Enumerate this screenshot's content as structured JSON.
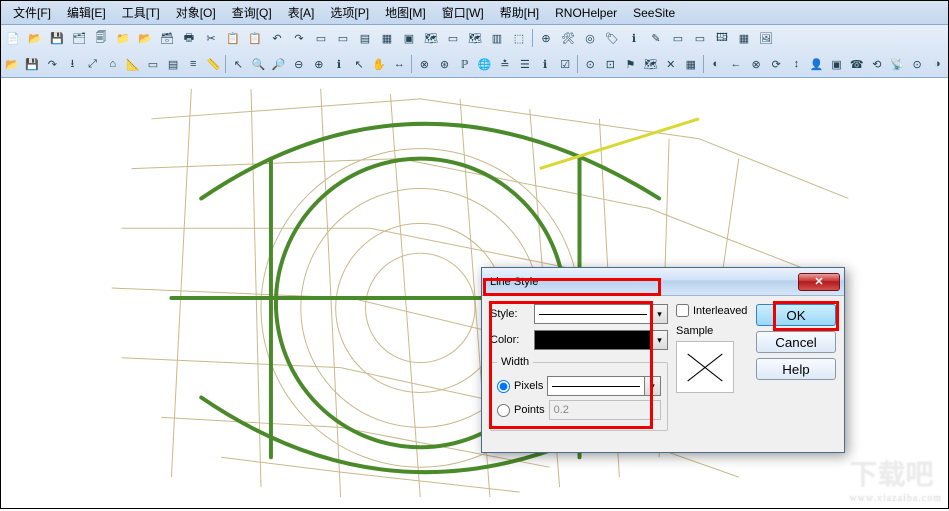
{
  "menubar": {
    "items": [
      "文件[F]",
      "编辑[E]",
      "工具[T]",
      "对象[O]",
      "查询[Q]",
      "表[A]",
      "选项[P]",
      "地图[M]",
      "窗口[W]",
      "帮助[H]",
      "RNOHelper",
      "SeeSite"
    ]
  },
  "toolbar_icons_row1": [
    "📄",
    "📂",
    "💾",
    "🗂",
    "🗐",
    "📁",
    "📂",
    "🗃",
    "🖶",
    "✂",
    "📋",
    "📋",
    "↶",
    "↷",
    "▭",
    "▭",
    "▤",
    "▦",
    "▣",
    "🗺",
    "▭",
    "🗺",
    "▥",
    "⬚",
    "|",
    "⊕",
    "🛠",
    "◎",
    "🏷",
    "ℹ",
    "✎",
    "▭",
    "▭",
    "🖽",
    "▦",
    "🖼"
  ],
  "toolbar_icons_row2": [
    "📂",
    "💾",
    "↷",
    "⭳",
    "⤢",
    "⌂",
    "📐",
    "▭",
    "▤",
    "≡",
    "📏",
    "|",
    "↖",
    "🔍",
    "🔎",
    "⊖",
    "⊕",
    "ℹ",
    "↖",
    "✋",
    "↔",
    "|",
    "⊗",
    "⊛",
    "ℙ",
    "🌐",
    "≛",
    "☰",
    "ℹ",
    "☑",
    "|",
    "⊙",
    "⊡",
    "⚑",
    "🗺",
    "✕",
    "▦",
    "|",
    "◐",
    "←",
    "⊗",
    "⟳",
    "↕",
    "👤",
    "▣",
    "☎",
    "⟲",
    "📡",
    "⊙",
    "◑"
  ],
  "dialog": {
    "title": "Line Style",
    "style_label": "Style:",
    "color_label": "Color:",
    "width_group": "Width",
    "pixels_label": "Pixels",
    "points_label": "Points",
    "points_value": "0.2",
    "interleaved_label": "Interleaved",
    "sample_label": "Sample",
    "ok": "OK",
    "cancel": "Cancel",
    "help": "Help"
  },
  "watermark": {
    "big": "下载吧",
    "small": "www.xiazaiba.com"
  }
}
